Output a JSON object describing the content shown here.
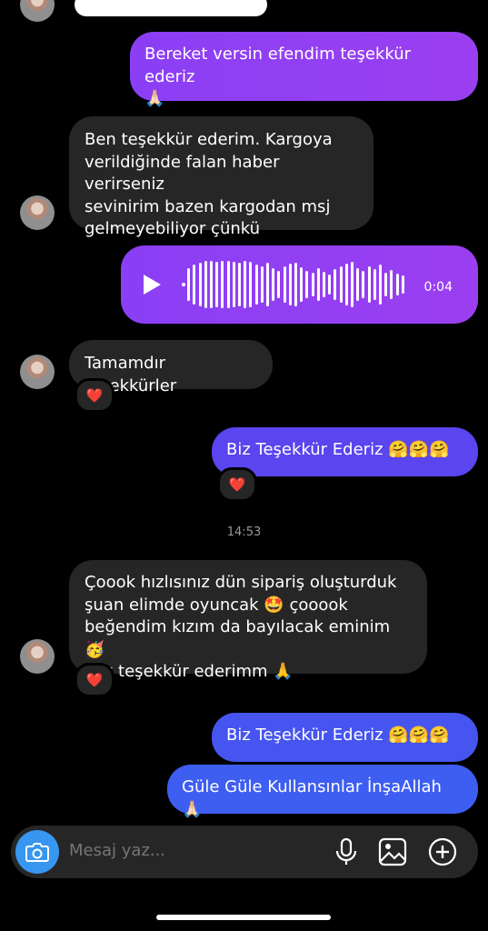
{
  "messages": {
    "m1": "Bereket versin efendim teşekkür ederiz\n🙏🏻",
    "m2": "Ben teşekkür ederim. Kargoya\nverildiğinde falan haber verirseniz\nsevinirim bazen kargodan msj\ngelmeyebiliyor çünkü",
    "voice_duration": "0:04",
    "m3": "Tamamdır teşekkürler",
    "m4": "Biz Teşekkür Ederiz 🤗🤗🤗",
    "timestamp": "14:53",
    "m5": "Çoook hızlısınız dün sipariş oluşturduk\nşuan elimde oyuncak 🤩 çooook\nbeğendim kızım da bayılacak eminim 🥳\nçok teşekkür ederimm 🙏",
    "m6": "Biz Teşekkür Ederiz 🤗🤗🤗",
    "m7": "Güle Güle Kullansınlar İnşaAllah 🙏🏻"
  },
  "reactions": {
    "heart": "❤️"
  },
  "composer": {
    "placeholder": "Mesaj yaz..."
  },
  "colors": {
    "purple": "#8a3ff5",
    "indigo": "#5a45ee",
    "blue": "#3e5ef1",
    "incoming": "#262626",
    "camera": "#3797f0"
  },
  "icons": [
    "camera-icon",
    "microphone-icon",
    "gallery-icon",
    "add-icon",
    "play-icon"
  ]
}
